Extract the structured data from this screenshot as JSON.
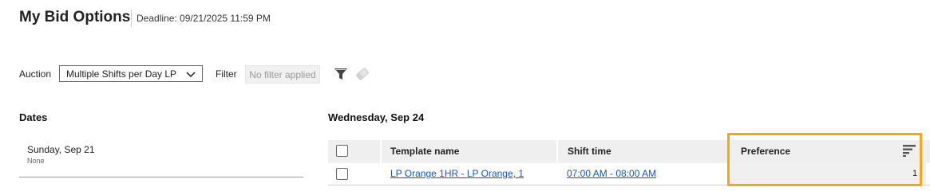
{
  "header": {
    "title": "My Bid Options",
    "deadline": "Deadline: 09/21/2025 11:59 PM"
  },
  "controls": {
    "auction_label": "Auction",
    "auction_selected": "Multiple Shifts per Day LP",
    "filter_label": "Filter",
    "filter_value": "No filter applied",
    "filter_icon": "funnel-icon",
    "clear_icon": "eraser-icon"
  },
  "dates": {
    "heading": "Dates",
    "items": [
      {
        "label": "Sunday, Sep 21",
        "sub": "None"
      }
    ]
  },
  "day": {
    "heading": "Wednesday, Sep 24",
    "columns": [
      "Template name",
      "Shift time",
      "Preference"
    ],
    "rows": [
      {
        "template": "LP Orange 1HR - LP Orange, 1",
        "shift_time": "07:00 AM - 08:00 AM",
        "preference": "1"
      }
    ]
  },
  "colors": {
    "link": "#1a55b0",
    "highlight": "#f0a818",
    "header_bg": "#efefef"
  }
}
